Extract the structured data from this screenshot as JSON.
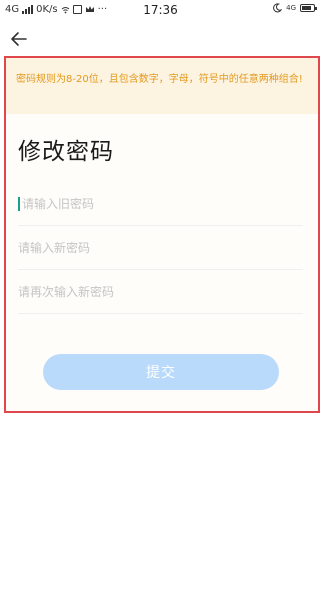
{
  "status_bar": {
    "network": "4G",
    "speed": "0K/s",
    "time": "17:36",
    "network_right": "4G",
    "more": "···"
  },
  "notice": {
    "text": "密码规则为8-20位，且包含数字，字母，符号中的任意两种组合!"
  },
  "page": {
    "title": "修改密码"
  },
  "form": {
    "old_password": {
      "value": "",
      "placeholder": "请输入旧密码"
    },
    "new_password": {
      "value": "",
      "placeholder": "请输入新密码"
    },
    "confirm_password": {
      "value": "",
      "placeholder": "请再次输入新密码"
    },
    "submit_label": "提交"
  },
  "colors": {
    "notice_text": "#e39a1c",
    "notice_bg": "#fdf3e1",
    "submit_bg": "#b9dafb",
    "frame_border": "#e0474c",
    "caret": "#1aa08a"
  },
  "icons": [
    "back-arrow-icon",
    "signal-icon",
    "wifi-icon",
    "sim-icon",
    "crown-icon",
    "moon-icon",
    "battery-icon"
  ]
}
